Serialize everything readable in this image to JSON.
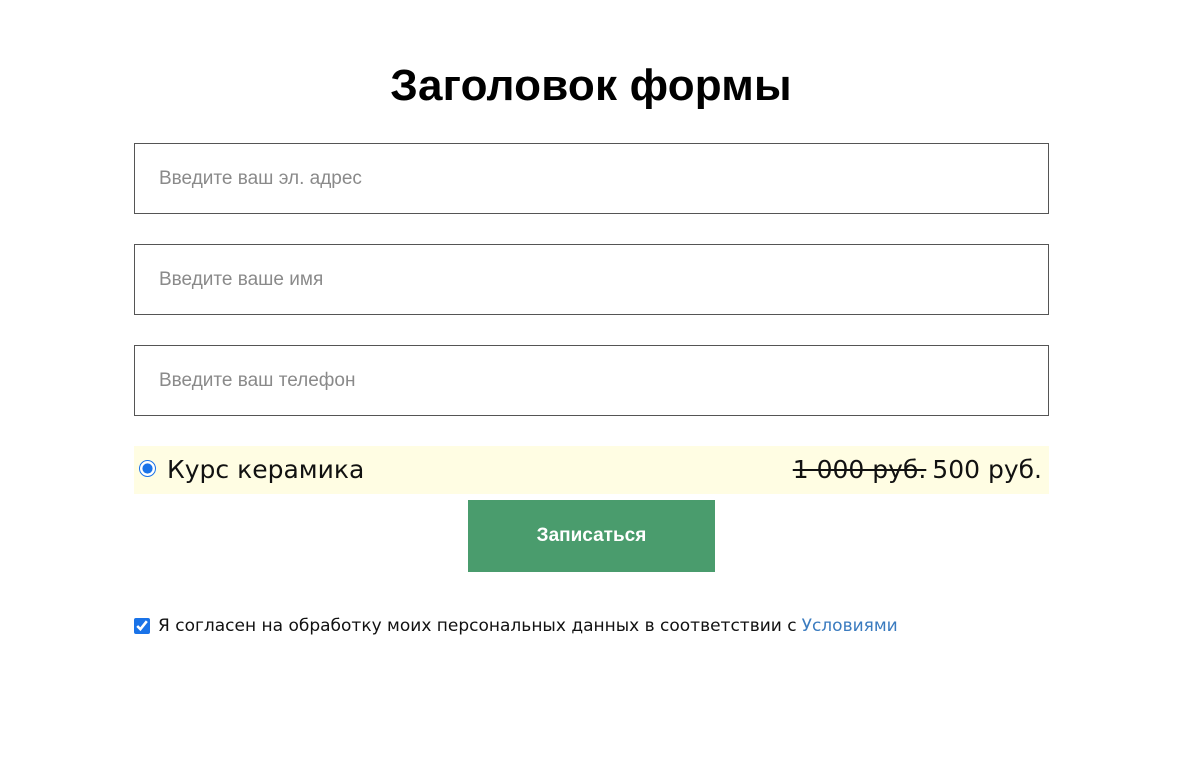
{
  "form": {
    "title": "Заголовок формы",
    "fields": {
      "email_placeholder": "Введите ваш эл. адрес",
      "name_placeholder": "Введите ваше имя",
      "phone_placeholder": "Введите ваш телефон"
    },
    "course": {
      "name": "Курс керамика",
      "old_price": "1 000 руб.",
      "new_price": "500 руб.",
      "selected": true,
      "highlight_color": "#fffde3"
    },
    "submit": {
      "label": "Записаться",
      "color": "#4a9c6d"
    },
    "consent": {
      "checked": true,
      "text": "Я согласен на обработку моих персональных данных в соответствии с",
      "link_label": "Условиями",
      "link_color": "#3a7bbf"
    }
  }
}
